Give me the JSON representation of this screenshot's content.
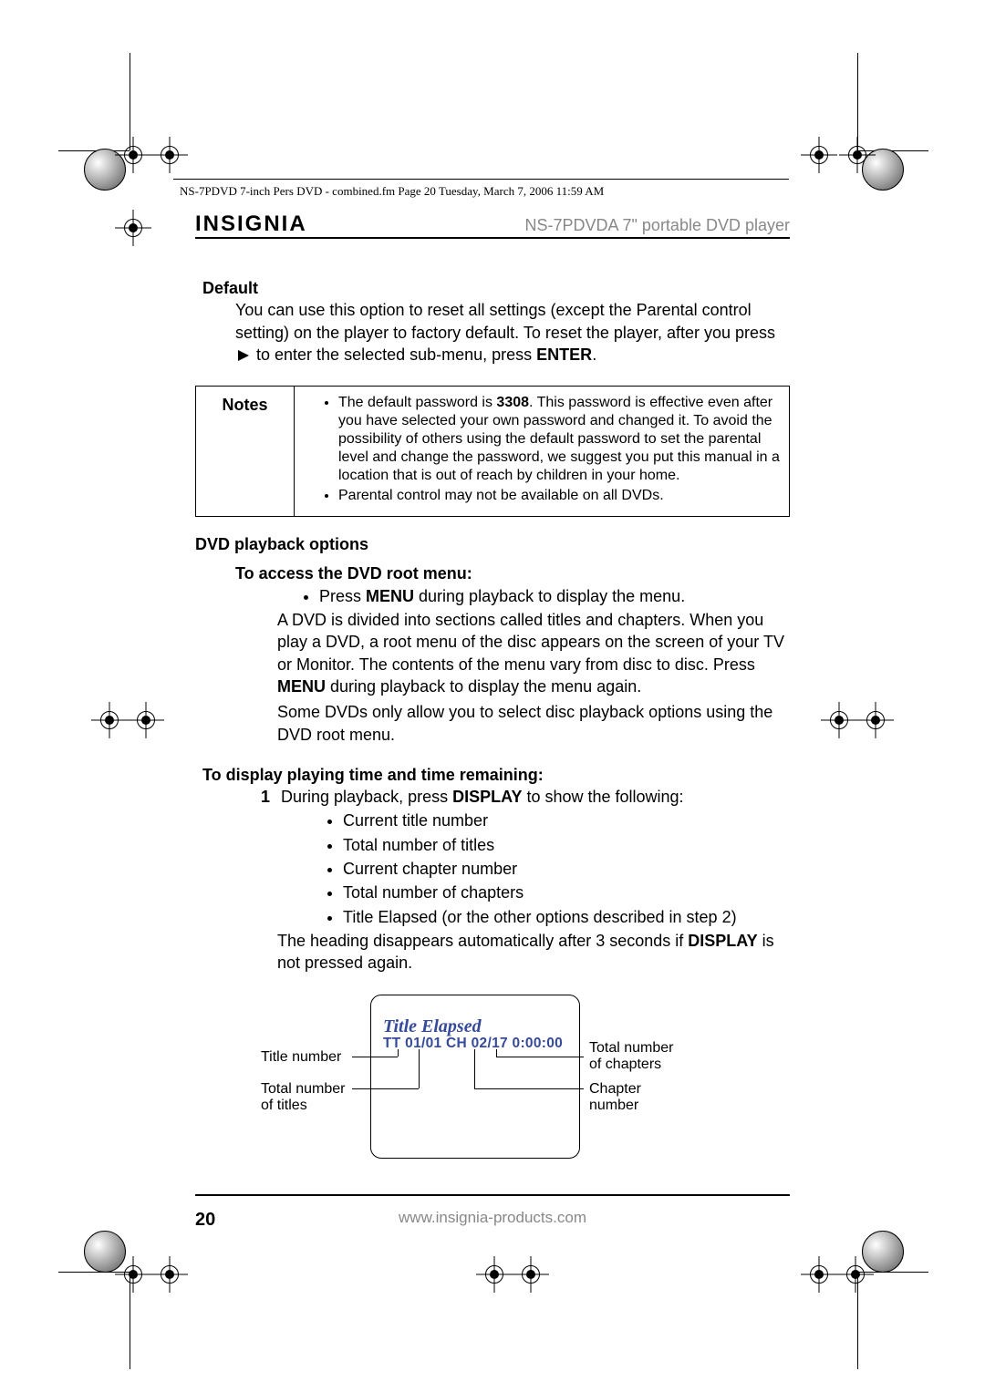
{
  "printmark": "NS-7PDVD 7-inch Pers DVD - combined.fm  Page 20  Tuesday, March 7, 2006  11:59 AM",
  "brand": "INSIGNIA",
  "product_header": "NS-7PDVDA 7\" portable DVD player",
  "default": {
    "heading": "Default",
    "paragraph_a": "You can use this option to reset all settings (except the Parental control setting) on the player to factory default. To reset the player, after you press ",
    "paragraph_b": " to enter the selected sub-menu, press ",
    "enter": "ENTER",
    "period": "."
  },
  "notes": {
    "label": "Notes",
    "items": [
      {
        "pre": "The default password is ",
        "pw": "3308",
        "post": ". This password is effective even after you have selected your own password and changed it. To avoid the possibility of others using the default password to set the parental level and change the password, we suggest you put this manual in a location that is out of reach by children in your home."
      },
      {
        "text": "Parental control may not be available on all DVDs."
      }
    ]
  },
  "playback": {
    "heading": "DVD playback options",
    "root_menu": {
      "heading": "To access the DVD root menu:",
      "bullet_pre": "Press ",
      "bullet_strong": "MENU",
      "bullet_post": " during playback to display the menu.",
      "para1_a": "A DVD is divided into sections called titles and chapters. When you play a DVD, a root menu of the disc appears on the screen of your TV or Monitor. The contents of the menu vary from disc to disc. Press ",
      "para1_strong": "MENU",
      "para1_b": " during playback to display the menu again.",
      "para2": "Some DVDs only allow you to select disc playback options using the DVD root menu."
    },
    "display": {
      "heading": "To display playing time and time remaining:",
      "step1_pre": "During playback, press ",
      "step1_strong": "DISPLAY",
      "step1_post": " to show the following:",
      "bullets": [
        "Current title number",
        "Total number of titles",
        "Current chapter number",
        "Total number of chapters",
        "Title Elapsed (or the other options described in step 2)"
      ],
      "tail_pre": "The heading disappears automatically after 3 seconds if ",
      "tail_strong": "DISPLAY",
      "tail_post": " is not pressed again."
    }
  },
  "diagram": {
    "osd_title": "Title Elapsed",
    "osd_data": "TT 01/01  CH 02/17  0:00:00",
    "labels": {
      "title_number": "Title number",
      "total_titles": "Total number\nof titles",
      "total_chapters": "Total number\nof chapters",
      "chapter_number": "Chapter\nnumber"
    }
  },
  "footer": {
    "page": "20",
    "url": "www.insignia-products.com"
  }
}
